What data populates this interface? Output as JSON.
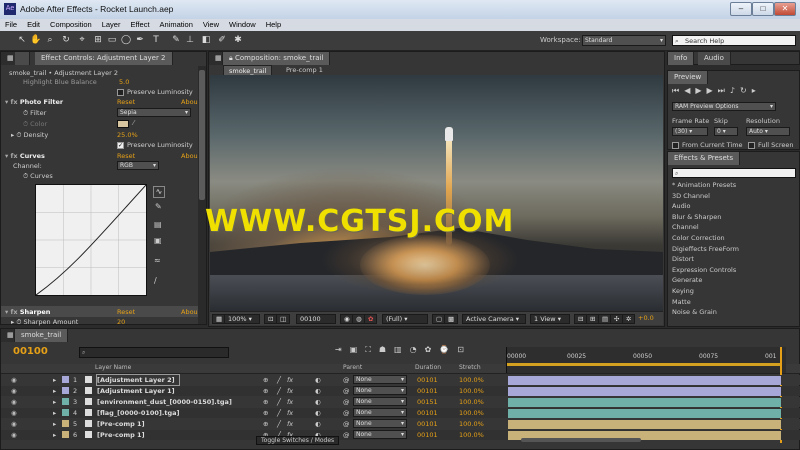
{
  "window": {
    "title": "Adobe After Effects - Rocket Launch.aep",
    "min": "–",
    "max": "□",
    "close": "✕"
  },
  "menu": [
    "File",
    "Edit",
    "Composition",
    "Layer",
    "Effect",
    "Animation",
    "View",
    "Window",
    "Help"
  ],
  "toolbar": {
    "workspace_label": "Workspace:",
    "workspace_value": "Standard",
    "search_placeholder": "Search Help"
  },
  "effect_controls": {
    "tab": "Effect Controls: Adjustment Layer 2",
    "header": "smoke_trail • Adjustment Layer 2",
    "truncated_row": "Highlight Blue Balance",
    "truncated_value": "5.0",
    "preserve_luminosity_1": "Preserve Luminosity",
    "photo_filter": {
      "name": "Photo Filter",
      "reset": "Reset",
      "about": "Abou",
      "filter_label": "Filter",
      "filter_value": "Sepia",
      "color_label": "Color",
      "density_label": "Density",
      "density_value": "25.0%",
      "preserve": "Preserve Luminosity"
    },
    "curves": {
      "name": "Curves",
      "reset": "Reset",
      "about": "Abou",
      "channel_label": "Channel:",
      "channel_value": "RGB",
      "curves_label": "Curves"
    },
    "sharpen": {
      "name": "Sharpen",
      "reset": "Reset",
      "about": "Abou",
      "amount_label": "Sharpen Amount",
      "amount_value": "20"
    }
  },
  "composition": {
    "tab": "Composition: smoke_trail",
    "subtabs": [
      "smoke_trail",
      "Pre-comp 1"
    ],
    "watermark": "WWW.CGTSJ.COM",
    "zoom": "100%",
    "timecode": "00100",
    "resolution": "(Full)",
    "camera": "Active Camera",
    "views": "1 View",
    "exposure": "+0.0"
  },
  "right_panel": {
    "tabs": [
      "Info",
      "Audio"
    ],
    "preview_tab": "Preview",
    "ram_options": "RAM Preview Options",
    "frame_rate_label": "Frame Rate",
    "skip_label": "Skip",
    "resolution_label": "Resolution",
    "frame_rate_value": "(30)",
    "skip_value": "0",
    "resolution_value": "Auto",
    "from_current": "From Current Time",
    "full_screen": "Full Screen",
    "effects_tab": "Effects & Presets",
    "effects_list": [
      "* Animation Presets",
      "3D Channel",
      "Audio",
      "Blur & Sharpen",
      "Channel",
      "Color Correction",
      "Digieffects FreeForm",
      "Distort",
      "Expression Controls",
      "Generate",
      "Keying",
      "Matte",
      "Noise & Grain"
    ]
  },
  "timeline": {
    "tab": "smoke_trail",
    "timecode": "00100",
    "columns": {
      "layer_name": "Layer Name",
      "parent": "Parent",
      "duration": "Duration",
      "stretch": "Stretch"
    },
    "ruler": [
      "00000",
      "00025",
      "00050",
      "00075",
      "001"
    ],
    "toggle_label": "Toggle Switches / Modes",
    "layers": [
      {
        "num": "1",
        "name": "[Adjustment Layer 2]",
        "parent": "None",
        "duration": "00101",
        "stretch": "100.0%",
        "color": "#a8a8d8"
      },
      {
        "num": "2",
        "name": "[Adjustment Layer 1]",
        "parent": "None",
        "duration": "00101",
        "stretch": "100.0%",
        "color": "#a8a8d8"
      },
      {
        "num": "3",
        "name": "[environment_dust_[0000-0150].tga]",
        "parent": "None",
        "duration": "00151",
        "stretch": "100.0%",
        "color": "#6fb0a8"
      },
      {
        "num": "4",
        "name": "[flag_[0000-0100].tga]",
        "parent": "None",
        "duration": "00101",
        "stretch": "100.0%",
        "color": "#6fb0a8"
      },
      {
        "num": "5",
        "name": "[Pre-comp 1]",
        "parent": "None",
        "duration": "00101",
        "stretch": "100.0%",
        "color": "#c8b27a"
      },
      {
        "num": "6",
        "name": "[Pre-comp 1]",
        "parent": "None",
        "duration": "00101",
        "stretch": "100.0%",
        "color": "#c8b27a"
      }
    ]
  }
}
